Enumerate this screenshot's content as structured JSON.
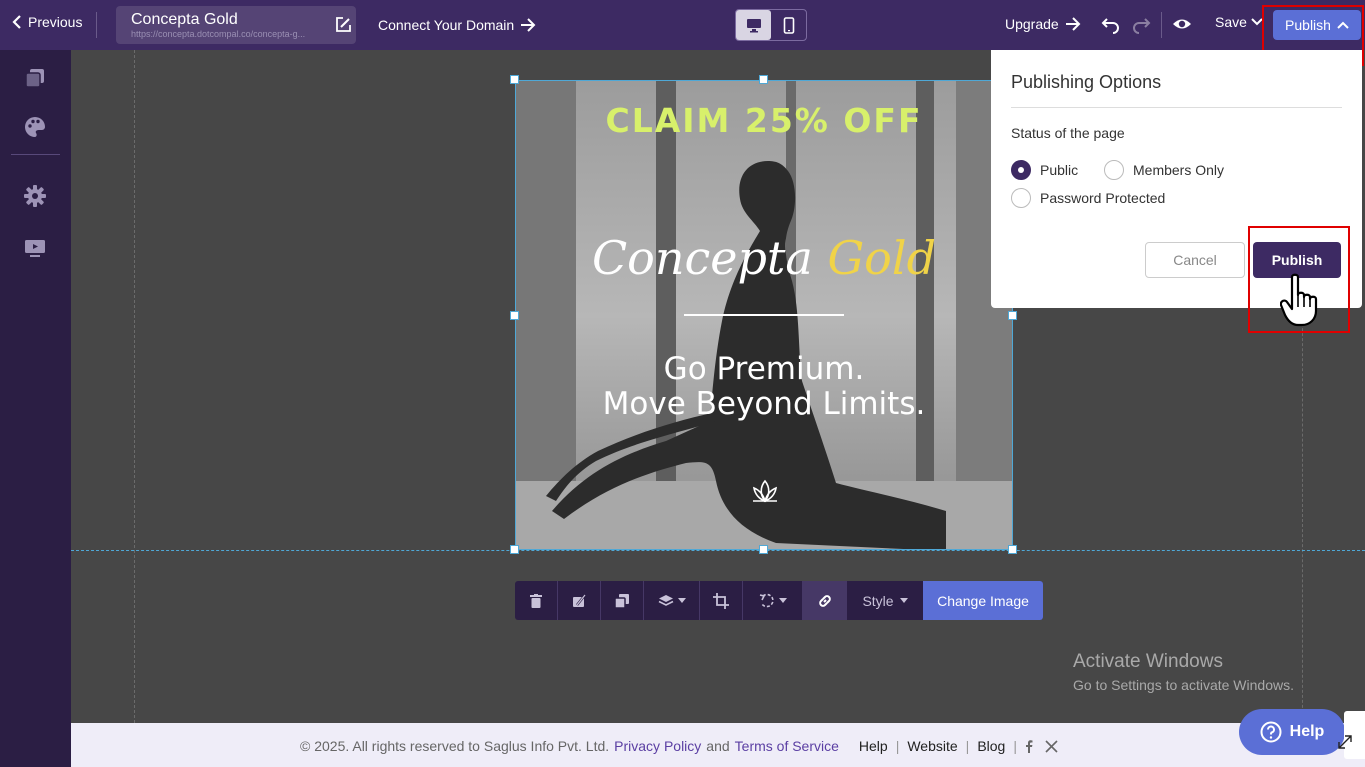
{
  "topbar": {
    "previous_label": "Previous",
    "site_title": "Concepta Gold",
    "site_url": "https://concepta.dotcompal.co/concepta-g...",
    "connect_domain": "Connect Your Domain",
    "upgrade": "Upgrade",
    "save": "Save",
    "publish": "Publish"
  },
  "image": {
    "claim": "CLAIM 25% OFF",
    "brand_word1": "Concepta",
    "brand_word2": "Gold",
    "tagline_line1": "Go Premium.",
    "tagline_line2": "Move Beyond Limits."
  },
  "toolbar": {
    "style_label": "Style",
    "change_image": "Change Image"
  },
  "publishing_panel": {
    "title": "Publishing Options",
    "status_label": "Status of the page",
    "options": [
      "Public",
      "Members Only",
      "Password Protected"
    ],
    "selected_option": "Public",
    "cancel": "Cancel",
    "publish": "Publish"
  },
  "watermark": {
    "line1": "Activate Windows",
    "line2": "Go to Settings to activate Windows."
  },
  "footer": {
    "copyright": "©  2025. All rights reserved to Saglus Info Pvt. Ltd.",
    "privacy": "Privacy Policy",
    "and": "and",
    "terms": "Terms of Service",
    "help": "Help",
    "website": "Website",
    "blog": "Blog"
  },
  "help_button": "Help",
  "colors": {
    "topbar": "#3d2a63",
    "sidebar": "#2b1e44",
    "accent": "#5b6fd6",
    "canvas": "#474747",
    "highlight": "#e00000"
  }
}
